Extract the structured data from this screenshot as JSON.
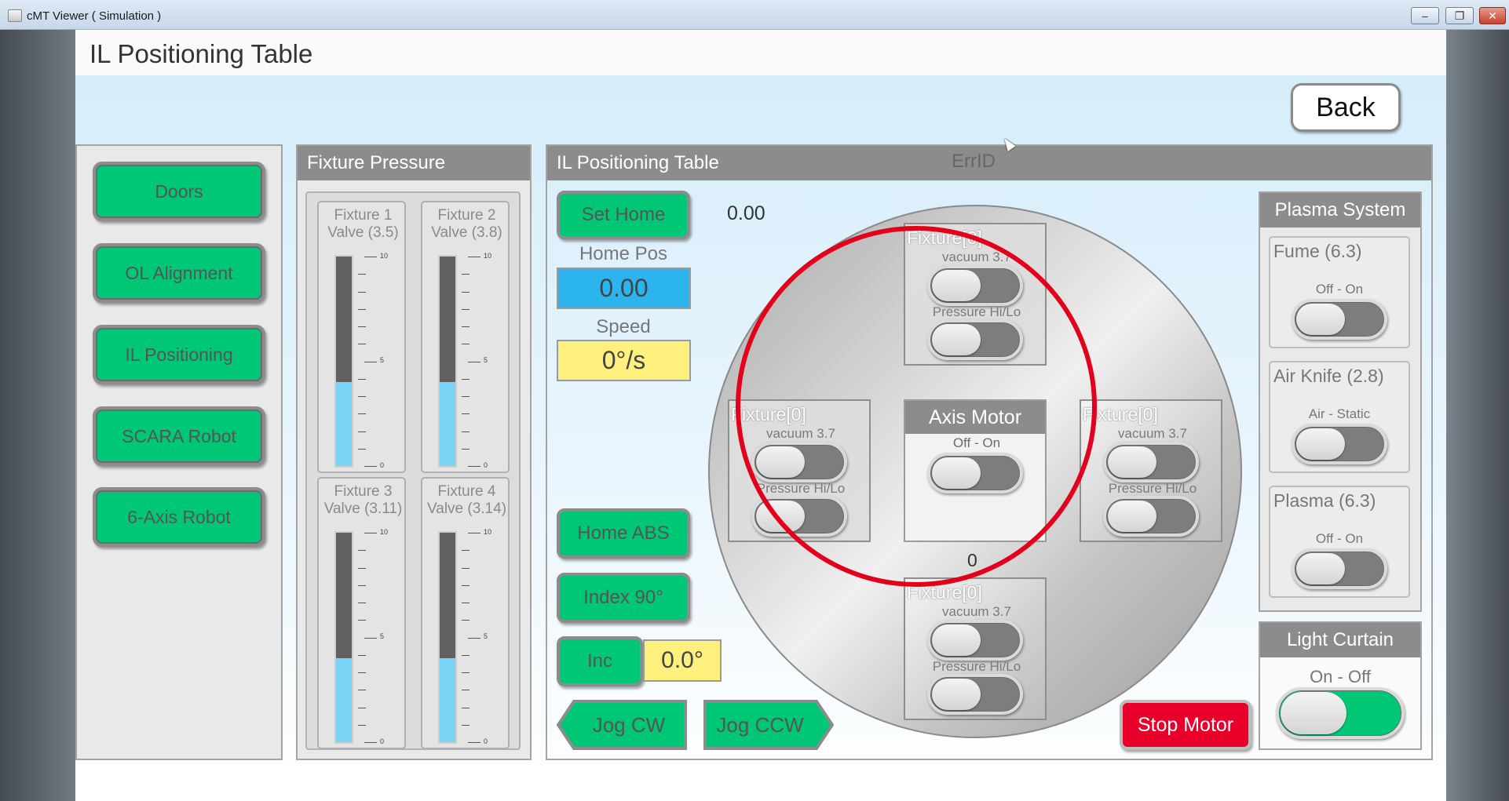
{
  "window": {
    "title": "cMT Viewer ( Simulation )",
    "minimize": "–",
    "maximize": "❐",
    "close": "✕"
  },
  "screen": {
    "title": "IL Positioning Table",
    "back_label": "Back"
  },
  "nav": {
    "items": [
      {
        "label": "Doors"
      },
      {
        "label": "OL Alignment"
      },
      {
        "label": "IL Positioning"
      },
      {
        "label": "SCARA Robot"
      },
      {
        "label": "6-Axis Robot"
      }
    ]
  },
  "fixture_pressure": {
    "title": "Fixture Pressure",
    "scale_max": "10",
    "scale_mid": "5",
    "scale_min": "0",
    "gauges": [
      {
        "name": "Fixture 1",
        "valve": "Valve (3.5)",
        "level": 0.4
      },
      {
        "name": "Fixture 2",
        "valve": "Valve (3.8)",
        "level": 0.4
      },
      {
        "name": "Fixture 3",
        "valve": "Valve (3.11)",
        "level": 0.4
      },
      {
        "name": "Fixture 4",
        "valve": "Valve (3.14)",
        "level": 0.4
      }
    ]
  },
  "positioning": {
    "title": "IL Positioning Table",
    "err_label": "ErrID",
    "set_home_label": "Set Home",
    "current_value": "0.00",
    "home_pos_label": "Home Pos",
    "home_pos_value": "0.00",
    "speed_label": "Speed",
    "speed_value": "0°/s",
    "home_abs_label": "Home ABS",
    "index_label": "Index 90°",
    "inc_label": "Inc",
    "inc_value": "0.0°",
    "jog_cw_label": "Jog CW",
    "jog_ccw_label": "Jog CCW",
    "stop_label": "Stop Motor",
    "position_counter": "0",
    "axis_motor": {
      "title": "Axis Motor",
      "option": "Off - On"
    },
    "fixtures": [
      {
        "title": "Fixture[0]",
        "vacuum": "vacuum 3.7",
        "pressure": "Pressure Hi/Lo"
      },
      {
        "title": "Fixture[0]",
        "vacuum": "vacuum 3.7",
        "pressure": "Pressure Hi/Lo"
      },
      {
        "title": "Fixture[0]",
        "vacuum": "vacuum 3.7",
        "pressure": "Pressure Hi/Lo"
      },
      {
        "title": "Fixture[0]",
        "vacuum": "vacuum 3.7",
        "pressure": "Pressure Hi/Lo"
      }
    ]
  },
  "plasma": {
    "title": "Plasma System",
    "groups": [
      {
        "title": "Fume (6.3)",
        "option": "Off - On"
      },
      {
        "title": "Air Knife (2.8)",
        "option": "Air - Static"
      },
      {
        "title": "Plasma (6.3)",
        "option": "Off - On"
      }
    ]
  },
  "light_curtain": {
    "title": "Light Curtain",
    "option": "On - Off"
  }
}
